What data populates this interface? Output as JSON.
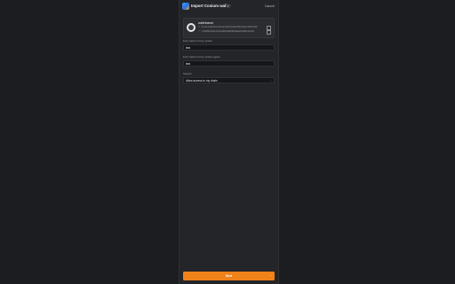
{
  "header": {
    "title": "Import Cosium wallet",
    "badge": "IX",
    "cancel_label": "Cancel"
  },
  "account": {
    "name": "walletname",
    "addresses": [
      {
        "network": "X",
        "address": "X-cosmos1dnzsmlsnwvv9sv2ua3e7l0pmfqvmt6dx7u06"
      },
      {
        "network": "Y",
        "address": "Y-0x6f9c4b0e7a41c2d2f1a9b58d3a6e0c9ffb21d7a3"
      }
    ]
  },
  "form": {
    "field1": {
      "label": "Enter wallet recovery phrase",
      "value": "test"
    },
    "field2": {
      "label": "Enter wallet recovery phrase (again)",
      "value": "test"
    },
    "field3": {
      "label": "Network",
      "value": "Allow access to my chain"
    }
  },
  "submit": {
    "label": "Next",
    "arrow": "→"
  },
  "colors": {
    "accent": "#f0821a",
    "background": "#1c1d20",
    "panel": "#242528"
  }
}
